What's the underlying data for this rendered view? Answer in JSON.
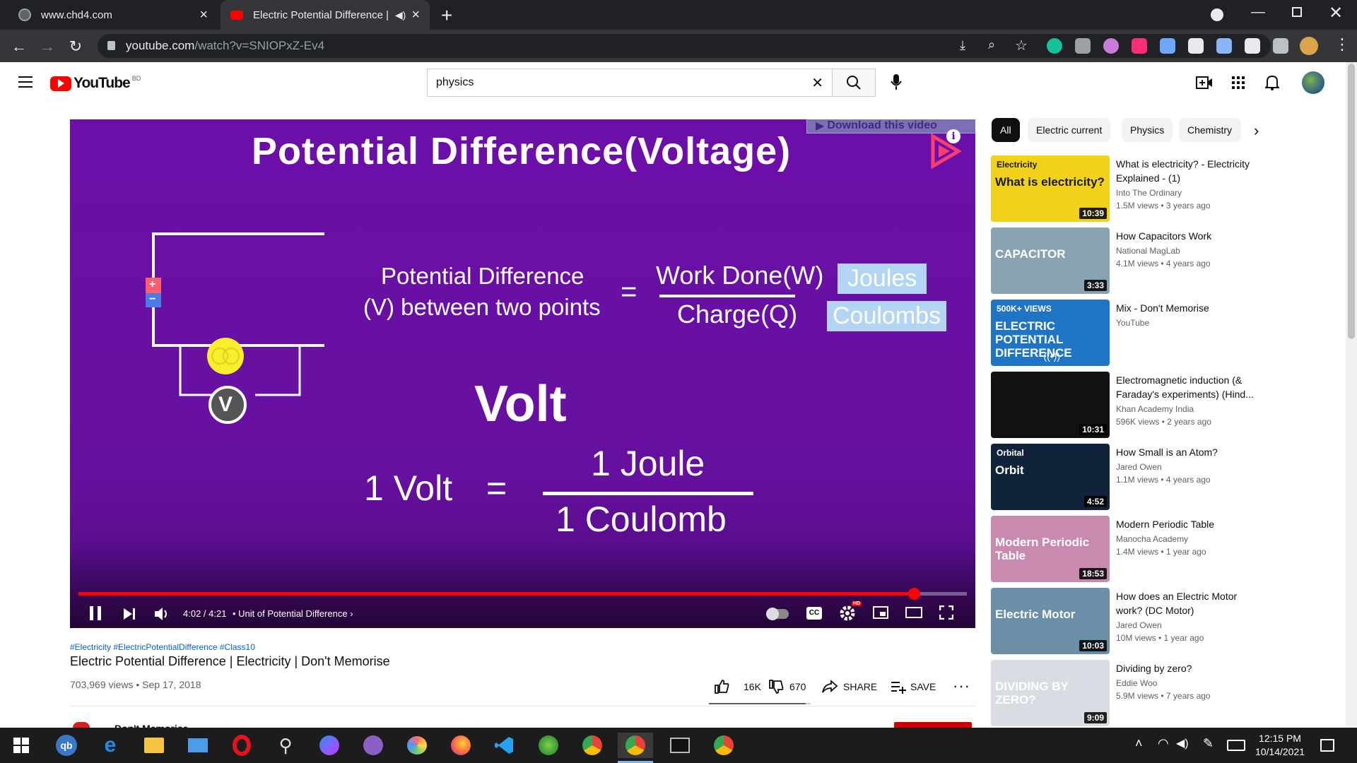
{
  "browser": {
    "tabs": [
      {
        "title": "www.chd4.com"
      },
      {
        "title": "Electric Potential Difference |"
      }
    ],
    "url_host": "youtube.com",
    "url_path": "/watch?v=SNIOPxZ-Ev4"
  },
  "youtube": {
    "logo_text": "YouTube",
    "region": "BD",
    "search_value": "physics"
  },
  "player": {
    "download_banner": "Download this video",
    "slide_title": "Potential Difference(Voltage)",
    "eq_left_1": "Potential Difference",
    "eq_left_2": "(V) between two points",
    "eq_equals": "=",
    "eq_num": "Work Done(W)",
    "eq_den": "Charge(Q)",
    "unit_num": "Joules",
    "unit_den": "Coulombs",
    "volt_heading": "Volt",
    "volt_left": "1 Volt",
    "volt_num": "1 Joule",
    "volt_den": "1 Coulomb",
    "meter_letter": "V",
    "battery_plus": "+",
    "battery_minus": "−",
    "time": "4:02 / 4:21",
    "chapter": "• Unit of Potential Difference",
    "hd_badge": "HD",
    "cc_label": "CC",
    "progress_fraction": 0.94
  },
  "video": {
    "hashtags": "#Electricity #ElectricPotentialDifference #Class10",
    "title": "Electric Potential Difference | Electricity | Don't Memorise",
    "meta": "703,969 views • Sep 17, 2018",
    "likes": "16K",
    "dislikes": "670",
    "share_label": "SHARE",
    "save_label": "SAVE",
    "channel_partial": "Don't Memorise"
  },
  "chips": [
    "All",
    "Electric current",
    "Physics",
    "Chemistry"
  ],
  "recommendations": [
    {
      "title": "What is electricity? - Electricity Explained - (1)",
      "channel": "Into The Ordinary",
      "meta": "1.5M views • 3 years ago",
      "duration": "10:39",
      "thumb_text": "What is electricity?",
      "thumb_small": "Electricity",
      "color": "#f2d11a"
    },
    {
      "title": "How Capacitors Work",
      "channel": "National MagLab",
      "meta": "4.1M views • 4 years ago",
      "duration": "3:33",
      "thumb_text": "CAPACITOR",
      "thumb_small": "",
      "color": "#8aa3b3"
    },
    {
      "title": "Mix - Don't Memorise",
      "channel": "YouTube",
      "meta": "",
      "duration": "",
      "thumb_text": "ELECTRIC POTENTIAL DIFFERENCE",
      "thumb_small": "500K+ VIEWS",
      "color": "#1f74c4"
    },
    {
      "title": "Electromagnetic induction (& Faraday's experiments) (Hind...",
      "channel": "Khan Academy India",
      "meta": "596K views • 2 years ago",
      "duration": "10:31",
      "thumb_text": "",
      "thumb_small": "",
      "color": "#111111"
    },
    {
      "title": "How Small is an Atom?",
      "channel": "Jared Owen",
      "meta": "1.1M views • 4 years ago",
      "duration": "4:52",
      "thumb_text": "Orbit",
      "thumb_small": "Orbital",
      "color": "#10233b"
    },
    {
      "title": "Modern Periodic Table",
      "channel": "Manocha Academy",
      "meta": "1.4M views • 1 year ago",
      "duration": "18:53",
      "thumb_text": "Modern Periodic Table",
      "thumb_small": "",
      "color": "#c98ab0"
    },
    {
      "title": "How does an Electric Motor work? (DC Motor)",
      "channel": "Jared Owen",
      "meta": "10M views • 1 year ago",
      "duration": "10:03",
      "thumb_text": "Electric Motor",
      "thumb_small": "",
      "color": "#6a8fa6"
    },
    {
      "title": "Dividing by zero?",
      "channel": "Eddie Woo",
      "meta": "5.9M views • 7 years ago",
      "duration": "9:09",
      "thumb_text": "DIVIDING BY ZERO?",
      "thumb_small": "",
      "color": "#d9dde3"
    }
  ],
  "system": {
    "time": "12:15 PM",
    "date": "10/14/2021"
  }
}
